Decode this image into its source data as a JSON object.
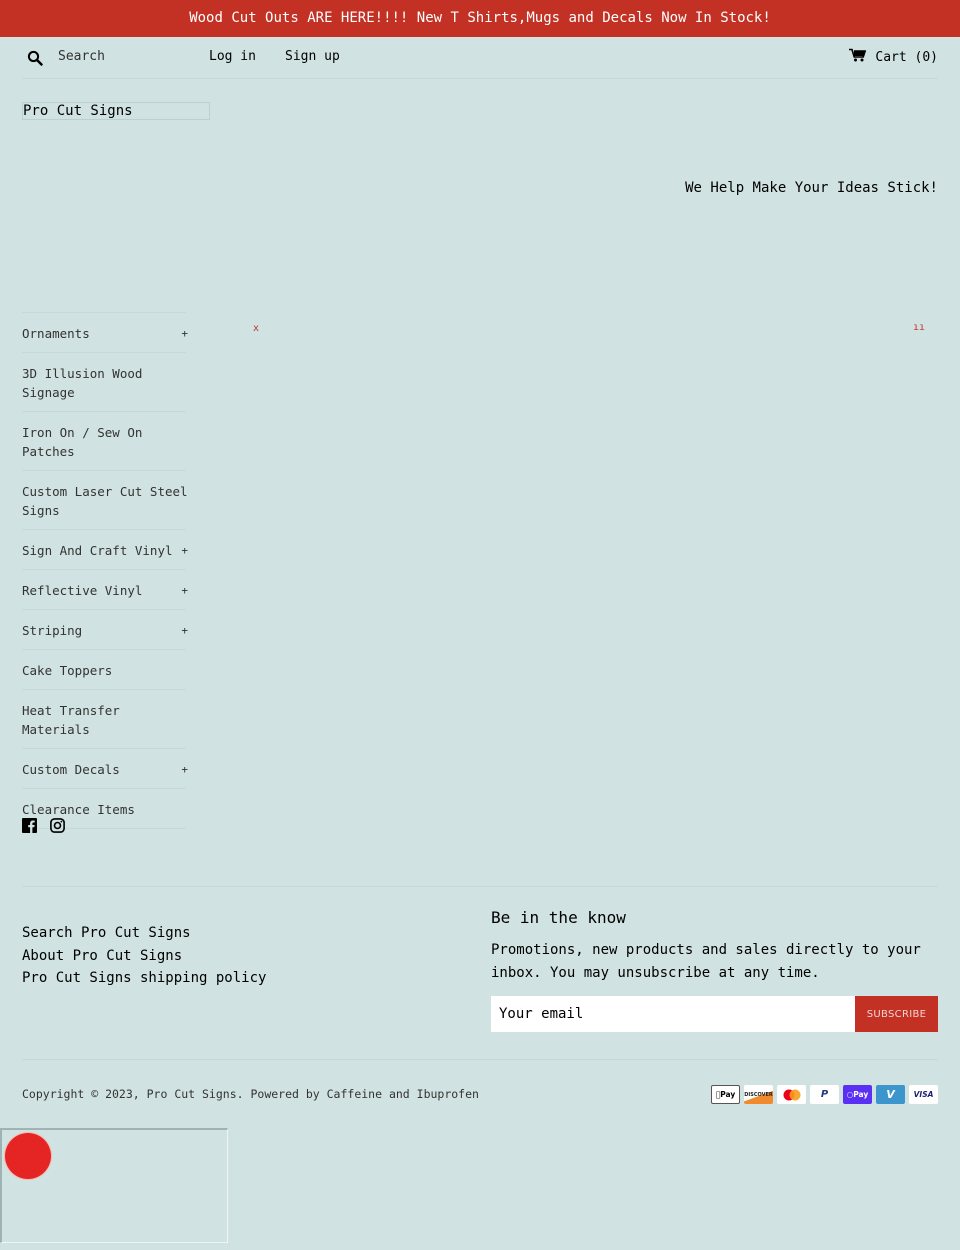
{
  "announcement": "Wood Cut Outs ARE HERE!!!! New T Shirts,Mugs and Decals Now In Stock!",
  "header": {
    "search_placeholder": "Search",
    "login": "Log in",
    "signup": "Sign up",
    "cart_label": "Cart (0)",
    "search_icon": "search-icon",
    "cart_icon": "cart-icon"
  },
  "logo_text": "Pro Cut Signs",
  "tagline": "We Help Make Your Ideas Stick!",
  "sidebar": {
    "items": [
      {
        "label": "Ornaments",
        "expand": "+"
      },
      {
        "label": "3D Illusion Wood Signage",
        "expand": ""
      },
      {
        "label": "Iron On / Sew On Patches",
        "expand": ""
      },
      {
        "label": "Custom Laser Cut Steel Signs",
        "expand": ""
      },
      {
        "label": "Sign And Craft Vinyl",
        "expand": "+"
      },
      {
        "label": "Reflective Vinyl",
        "expand": "+"
      },
      {
        "label": "Striping",
        "expand": "+"
      },
      {
        "label": "Cake Toppers",
        "expand": ""
      },
      {
        "label": "Heat Transfer Materials",
        "expand": ""
      },
      {
        "label": "Custom Decals",
        "expand": "+"
      },
      {
        "label": "Clearance Items",
        "expand": ""
      }
    ],
    "social": [
      "facebook-icon",
      "instagram-icon"
    ]
  },
  "broken_images": [
    "x",
    "ıı"
  ],
  "footer": {
    "links": [
      "Search Pro Cut Signs",
      "About Pro Cut Signs",
      "Pro Cut Signs shipping policy"
    ],
    "newsletter": {
      "title": "Be in the know",
      "text": "Promotions, new products and sales directly to your inbox. You may unsubscribe at any time.",
      "email_placeholder": "Your email",
      "button": "SUBSCRIBE"
    },
    "copyright": "Copyright © 2023, Pro Cut Signs. Powered by Caffeine and Ibuprofen",
    "payments": [
      "Apple Pay",
      "Discover",
      "Mastercard",
      "PayPal",
      "Shop Pay",
      "Venmo",
      "Visa"
    ]
  },
  "colors": {
    "accent": "#c23124",
    "background": "#d0e2e1",
    "widget_dot": "#e52424"
  }
}
